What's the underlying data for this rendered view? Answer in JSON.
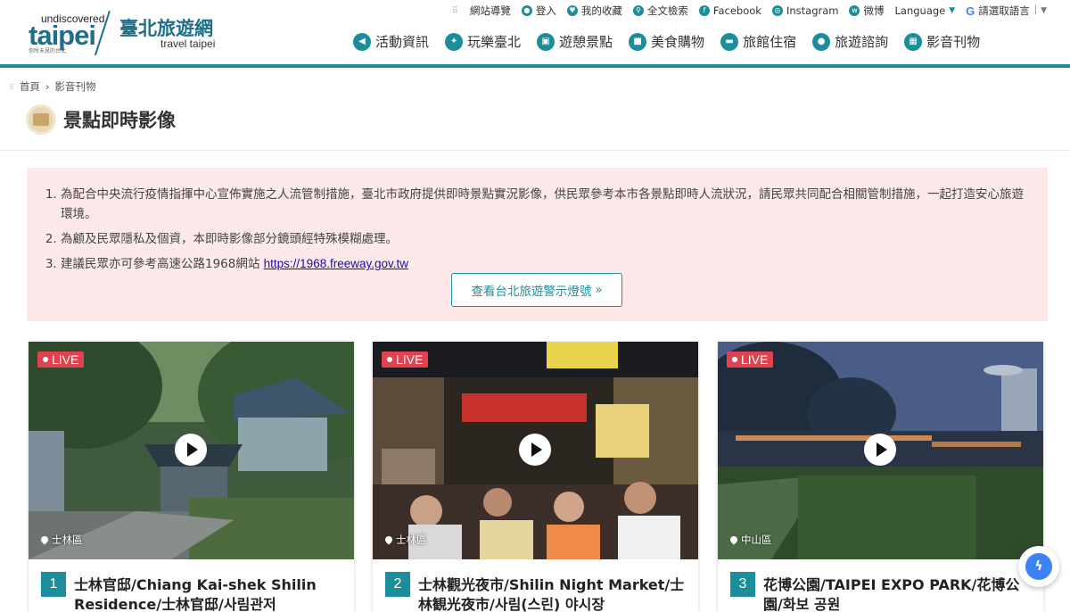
{
  "logo": {
    "undiscovered": "undiscovered",
    "taipei": "taipei",
    "tagline": "你所未見的台北",
    "zh": "臺北旅遊網",
    "en": "travel taipei"
  },
  "top_links": [
    {
      "label": "網站導覽",
      "icon": "sitemap-icon"
    },
    {
      "label": "登入",
      "icon": "user-icon"
    },
    {
      "label": "我的收藏",
      "icon": "favorite-icon"
    },
    {
      "label": "全文檢索",
      "icon": "search-icon"
    },
    {
      "label": "Facebook",
      "icon": "facebook-icon"
    },
    {
      "label": "Instagram",
      "icon": "instagram-icon"
    },
    {
      "label": "微博",
      "icon": "weibo-icon"
    },
    {
      "label": "Language",
      "icon": "caret-down-icon"
    },
    {
      "label": "請選取語言",
      "icon": "google-icon"
    }
  ],
  "nav": [
    {
      "label": "活動資訊",
      "icon": "megaphone-icon"
    },
    {
      "label": "玩樂臺北",
      "icon": "play-icon"
    },
    {
      "label": "遊憩景點",
      "icon": "photo-icon"
    },
    {
      "label": "美食購物",
      "icon": "shopping-icon"
    },
    {
      "label": "旅館住宿",
      "icon": "hotel-icon"
    },
    {
      "label": "旅遊諮詢",
      "icon": "info-icon"
    },
    {
      "label": "影音刊物",
      "icon": "media-icon"
    }
  ],
  "breadcrumb": {
    "home": "首頁",
    "current": "影音刊物"
  },
  "page_title": "景點即時影像",
  "notice": {
    "items": [
      "為配合中央流行疫情指揮中心宣佈實施之人流管制措施，臺北市政府提供即時景點實況影像，供民眾參考本市各景點即時人流狀況，請民眾共同配合相關管制措施，一起打造安心旅遊環境。",
      "為顧及民眾隱私及個資，本即時影像部分鏡頭經特殊模糊處理。",
      "建議民眾亦可參考高速公路1968網站 "
    ],
    "link": "https://1968.freeway.gov.tw",
    "button": "查看台北旅遊警示燈號"
  },
  "live_label": "LIVE",
  "cards": [
    {
      "num": "1",
      "district": "士林區",
      "title": "士林官邸/Chiang Kai-shek Shilin Residence/士林官邸/사림관저"
    },
    {
      "num": "2",
      "district": "士林區",
      "title": "士林觀光夜市/Shilin Night Market/士林観光夜市/사림(스린) 야시장"
    },
    {
      "num": "3",
      "district": "中山區",
      "title": "花博公園/TAIPEI EXPO PARK/花博公園/화보 공원"
    }
  ]
}
